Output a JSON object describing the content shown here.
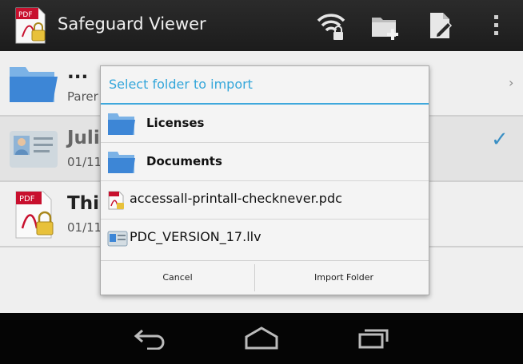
{
  "app": {
    "title": "Safeguard Viewer"
  },
  "background_list": {
    "rows": [
      {
        "title": "...",
        "subtitle": "Parer"
      },
      {
        "title": "Julie",
        "subtitle": "01/11"
      },
      {
        "title": "This",
        "subtitle": "01/11"
      }
    ]
  },
  "dialog": {
    "title": "Select folder to import",
    "items": [
      {
        "label": "Licenses",
        "kind": "folder",
        "icon": "folder-icon"
      },
      {
        "label": "Documents",
        "kind": "folder",
        "icon": "folder-icon"
      },
      {
        "label": "accessall-printall-checknever.pdc",
        "kind": "file",
        "icon": "pdf-lock-icon"
      },
      {
        "label": "PDC_VERSION_17.llv",
        "kind": "file",
        "icon": "license-card-icon"
      }
    ],
    "cancel_label": "Cancel",
    "import_label": "Import Folder"
  },
  "colors": {
    "accent": "#33a6da",
    "actionbar": "#222222",
    "navbar": "#050505"
  }
}
